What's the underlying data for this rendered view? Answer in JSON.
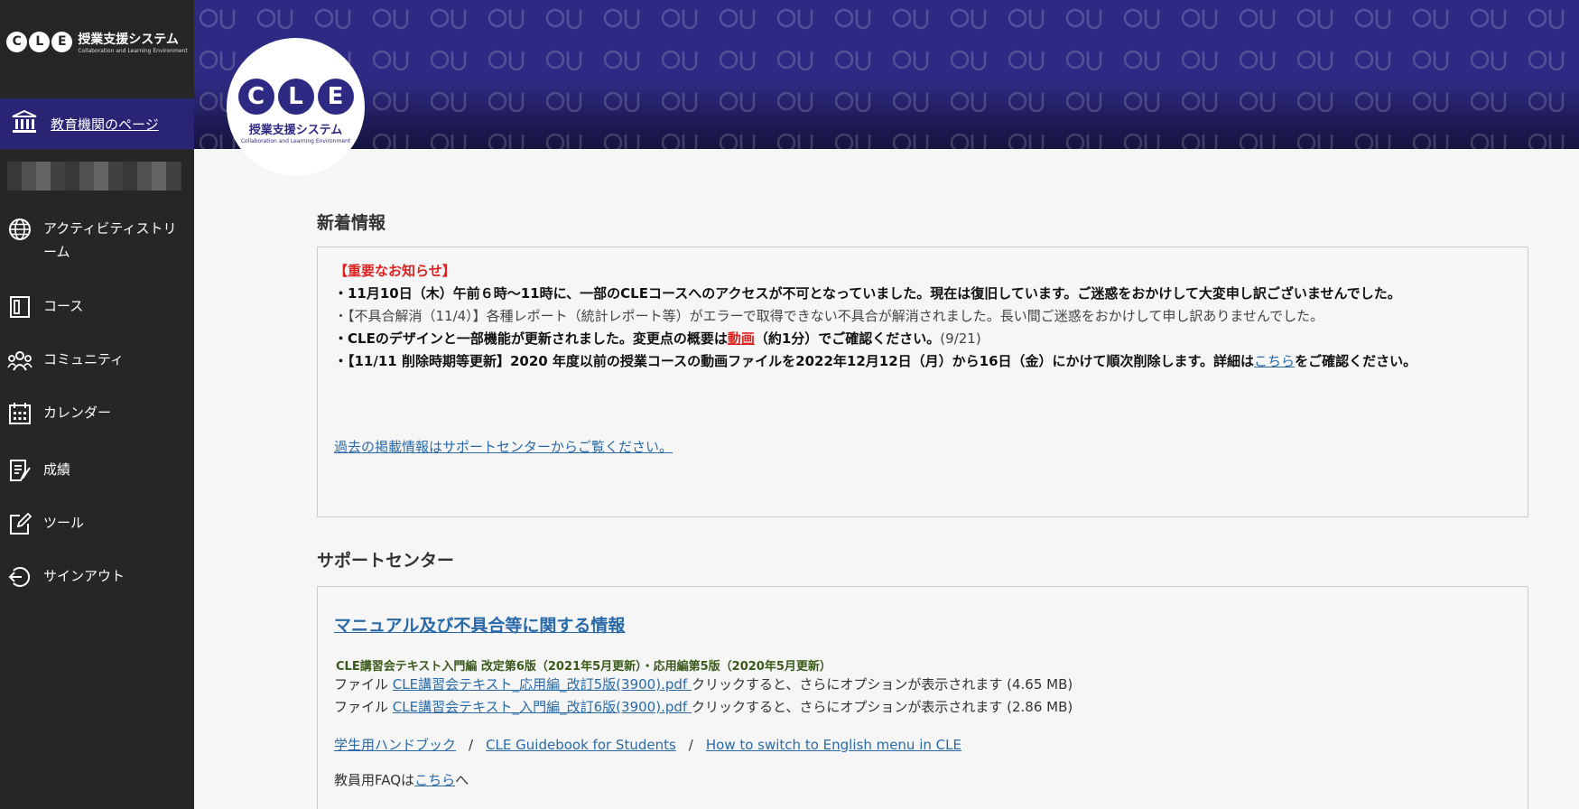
{
  "sidebar": {
    "logo": {
      "letters": [
        "C",
        "L",
        "E"
      ],
      "jp": "授業支援システム",
      "en": "Collaboration and Learning Environment"
    },
    "institution_label": "教育機関のページ",
    "nav": [
      {
        "label": "アクティビティストリーム",
        "icon": "globe-icon"
      },
      {
        "label": "コース",
        "icon": "course-icon"
      },
      {
        "label": "コミュニティ",
        "icon": "community-icon"
      },
      {
        "label": "カレンダー",
        "icon": "calendar-icon"
      },
      {
        "label": "成績",
        "icon": "grades-icon"
      },
      {
        "label": "ツール",
        "icon": "tools-icon"
      },
      {
        "label": "サインアウト",
        "icon": "signout-icon"
      }
    ]
  },
  "banner": {
    "letters": [
      "C",
      "L",
      "E"
    ],
    "jp": "授業支援システム",
    "en": "Collaboration and Learning Environment"
  },
  "news": {
    "title": "新着情報",
    "important": "【重要なお知らせ】",
    "line1": "・11月10日（木）午前６時〜11時に、一部のCLEコースへのアクセスが不可となっていました。現在は復旧しています。ご迷惑をおかけして大変申し訳ございませんでした。",
    "line2": "・【不具合解消（11/4）】各種レポート（統計レポート等）がエラーで取得できない不具合が解消されました。長い間ご迷惑をおかけして申し訳ありませんでした。",
    "line3_a": "・CLEのデザインと一部機能が更新されました。変更点の概要は",
    "line3_link": "動画",
    "line3_b": "（約1分）でご確認ください。",
    "line3_c": "(9/21)",
    "line4_a": "・【11/11 削除時期等更新】2020 年度以前の授業コースの動画ファイルを2022年12月12日（月）から16日（金）にかけて順次削除します。詳細は",
    "line4_link": "こちら",
    "line4_b": "をご確認ください。",
    "past_link": "過去の掲載情報はサポートセンターからご覧ください。"
  },
  "support": {
    "title": "サポートセンター",
    "manual_link": "マニュアル及び不具合等に関する情報",
    "note": "CLE講習会テキスト入門編 改定第6版（2021年5月更新）・応用編第5版（2020年5月更新）",
    "files": [
      {
        "prefix": "ファイル ",
        "name": "CLE講習会テキスト_応用編_改訂5版(3900).pdf ",
        "suffix": "クリックすると、さらにオプションが表示されます (4.65 MB)"
      },
      {
        "prefix": "ファイル ",
        "name": "CLE講習会テキスト_入門編_改訂6版(3900).pdf ",
        "suffix": "クリックすると、さらにオプションが表示されます (2.86 MB)"
      }
    ],
    "links": {
      "handbook": "学生用ハンドブック",
      "sep1": "/",
      "guidebook": "CLE Guidebook for Students",
      "sep2": "/",
      "english": "How to switch to English menu in CLE"
    },
    "faq_prefix": "教員用FAQは",
    "faq_link": "こちら",
    "faq_suffix": "へ"
  },
  "colors": {
    "sidebar": "#262626",
    "accent": "#2e2a83",
    "link": "#2a6aa8",
    "alert": "#dd2222"
  }
}
